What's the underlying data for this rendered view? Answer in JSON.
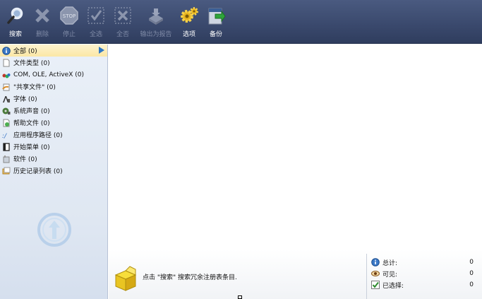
{
  "toolbar": {
    "buttons": [
      {
        "label": "搜索",
        "icon": "search-icon",
        "enabled": true
      },
      {
        "label": "删除",
        "icon": "delete-icon",
        "enabled": false
      },
      {
        "label": "停止",
        "icon": "stop-icon",
        "enabled": false
      },
      {
        "label": "全选",
        "icon": "select-all-icon",
        "enabled": false
      },
      {
        "label": "全否",
        "icon": "deselect-all-icon",
        "enabled": false
      },
      {
        "label": "输出为报告",
        "icon": "export-report-icon",
        "enabled": false
      },
      {
        "label": "选项",
        "icon": "gear-icon",
        "enabled": true
      },
      {
        "label": "备份",
        "icon": "backup-icon",
        "enabled": true
      }
    ]
  },
  "sidebar": {
    "items": [
      {
        "label": "全部 (0)",
        "icon": "info-icon"
      },
      {
        "label": "文件类型 (0)",
        "icon": "file-icon"
      },
      {
        "label": "COM, OLE, ActiveX (0)",
        "icon": "com-icon"
      },
      {
        "label": "\"共享文件\" (0)",
        "icon": "shared-file-icon"
      },
      {
        "label": "字体 (0)",
        "icon": "font-icon"
      },
      {
        "label": "系统声音 (0)",
        "icon": "sound-icon"
      },
      {
        "label": "帮助文件 (0)",
        "icon": "help-file-icon"
      },
      {
        "label": "应用程序路径 (0)",
        "icon": "app-path-icon"
      },
      {
        "label": "开始菜单 (0)",
        "icon": "start-menu-icon"
      },
      {
        "label": "软件 (0)",
        "icon": "software-icon"
      },
      {
        "label": "历史记录列表 (0)",
        "icon": "history-icon"
      }
    ]
  },
  "status": {
    "hint": "点击 \"搜索\" 搜索冗余注册表条目.",
    "total_label": "总计:",
    "total_value": "0",
    "visible_label": "可见:",
    "visible_value": "0",
    "selected_label": "已选择:",
    "selected_value": "0"
  },
  "colors": {
    "toolbar": "#3b4a6e",
    "sidebar": "#dfe7f2",
    "selected": "#fbe7a5",
    "accent": "#2f78c4"
  }
}
